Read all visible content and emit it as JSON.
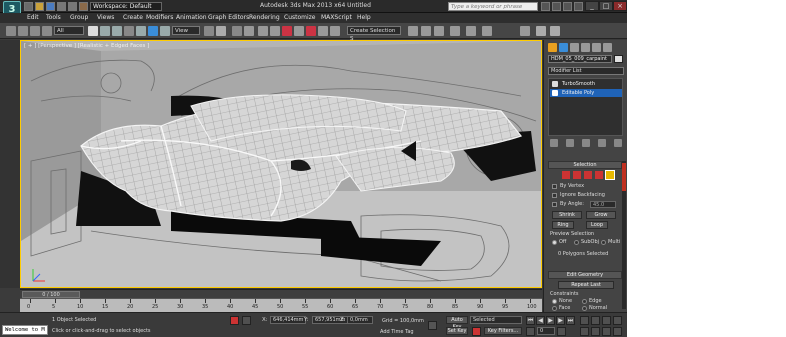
{
  "window": {
    "logo": "3",
    "workspace": "Workspace: Default",
    "title": "Autodesk 3ds Max 2013 x64    Untitled",
    "search_placeholder": "Type a keyword or phrase",
    "controls": [
      "_",
      "□",
      "×"
    ]
  },
  "menu": [
    "Edit",
    "Tools",
    "Group",
    "Views",
    "Create",
    "Modifiers",
    "Animation",
    "Graph Editors",
    "Rendering",
    "Customize",
    "MAXScript",
    "Help"
  ],
  "toolbar": {
    "selection_filter": "All",
    "coord_system": "View",
    "selection_set": "Create Selection S"
  },
  "viewport": {
    "label": "[ + ] [Perspective ] [Realistic + Edged Faces ]"
  },
  "command_panel": {
    "object_name": "HDM_05_009_carpaint",
    "modifier_list": "Modifier List",
    "stack": [
      {
        "label": "TurboSmooth",
        "selected": false
      },
      {
        "label": "Editable Poly",
        "selected": true
      }
    ],
    "selection": {
      "header": "Selection",
      "by_vertex": "By Vertex",
      "ignore_backfacing": "Ignore Backfacing",
      "by_angle": "By Angle:",
      "by_angle_value": "45.0",
      "shrink": "Shrink",
      "grow": "Grow",
      "ring": "Ring",
      "loop": "Loop",
      "preview_selection": "Preview Selection",
      "preview_off": "Off",
      "preview_subobj": "SubObj",
      "preview_multi": "Multi",
      "status": "0 Polygons Selected"
    },
    "edit_geometry": {
      "header": "Edit Geometry",
      "repeat_last": "Repeat Last",
      "constraints": "Constraints",
      "none": "None",
      "edge": "Edge",
      "face": "Face",
      "normal": "Normal"
    }
  },
  "timeline": {
    "frame": "0 / 100",
    "ticks": [
      "0",
      "5",
      "10",
      "15",
      "20",
      "25",
      "30",
      "35",
      "40",
      "45",
      "50",
      "55",
      "60",
      "65",
      "70",
      "75",
      "80",
      "85",
      "90",
      "95",
      "100"
    ]
  },
  "status": {
    "maxscript": "Welcome to M",
    "objects_selected": "1 Object Selected",
    "prompt": "Click or click-and-drag to select objects",
    "x_label": "X:",
    "x_value": "646,414mm",
    "y_label": "Y:",
    "y_value": "657,951mm",
    "z_label": "Z:",
    "z_value": "0,0mm",
    "grid": "Grid = 100,0mm",
    "add_time_tag": "Add Time Tag",
    "auto_key": "Auto Key",
    "set_key": "Set Key",
    "key_mode": "Selected",
    "key_filters": "Key Filters...",
    "current_frame": "0"
  }
}
